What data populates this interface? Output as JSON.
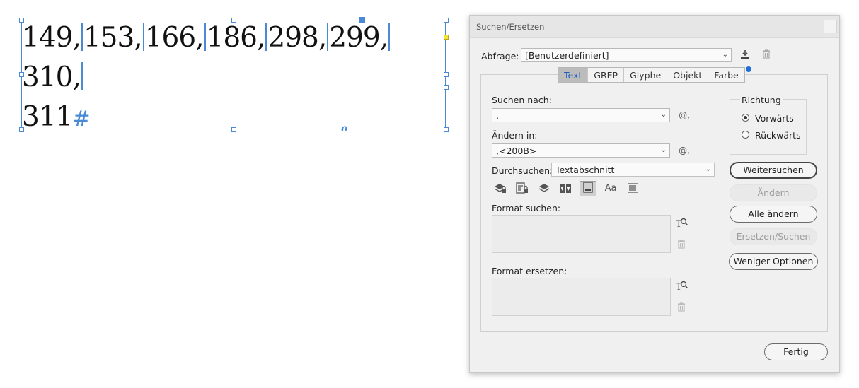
{
  "document": {
    "line1_parts": [
      "149,",
      "153,",
      "166,",
      "186,",
      "298,",
      "299,",
      "310,"
    ],
    "line2": "311",
    "paragraph_mark": "#"
  },
  "dialog": {
    "title": "Suchen/Ersetzen",
    "query": {
      "label": "Abfrage:",
      "value": "[Benutzerdefiniert]"
    },
    "tabs": [
      "Text",
      "GREP",
      "Glyphe",
      "Objekt",
      "Farbe"
    ],
    "active_tab": "Text",
    "find": {
      "label": "Suchen nach:",
      "value": ","
    },
    "change": {
      "label": "Ändern in:",
      "value": ",<200B>"
    },
    "search_in": {
      "label": "Durchsuchen:",
      "value": "Textabschnitt"
    },
    "format_find_label": "Format suchen:",
    "format_change_label": "Format ersetzen:",
    "direction": {
      "label": "Richtung",
      "options": [
        "Vorwärts",
        "Rückwärts"
      ],
      "selected": "Vorwärts"
    },
    "buttons": {
      "find_next": "Weitersuchen",
      "change": "Ändern",
      "change_all": "Alle ändern",
      "change_find": "Ersetzen/Suchen",
      "fewer_options": "Weniger Optionen",
      "done": "Fertig"
    },
    "special_char_symbol": "@,",
    "case_icon_text": "Aa",
    "icons": [
      "save-query-icon",
      "delete-query-icon",
      "locked-layers-icon",
      "locked-stories-icon",
      "hidden-layers-icon",
      "master-pages-icon",
      "footnotes-icon",
      "case-sensitive-icon",
      "whole-word-icon",
      "format-find-icon",
      "format-clear-icon"
    ]
  }
}
